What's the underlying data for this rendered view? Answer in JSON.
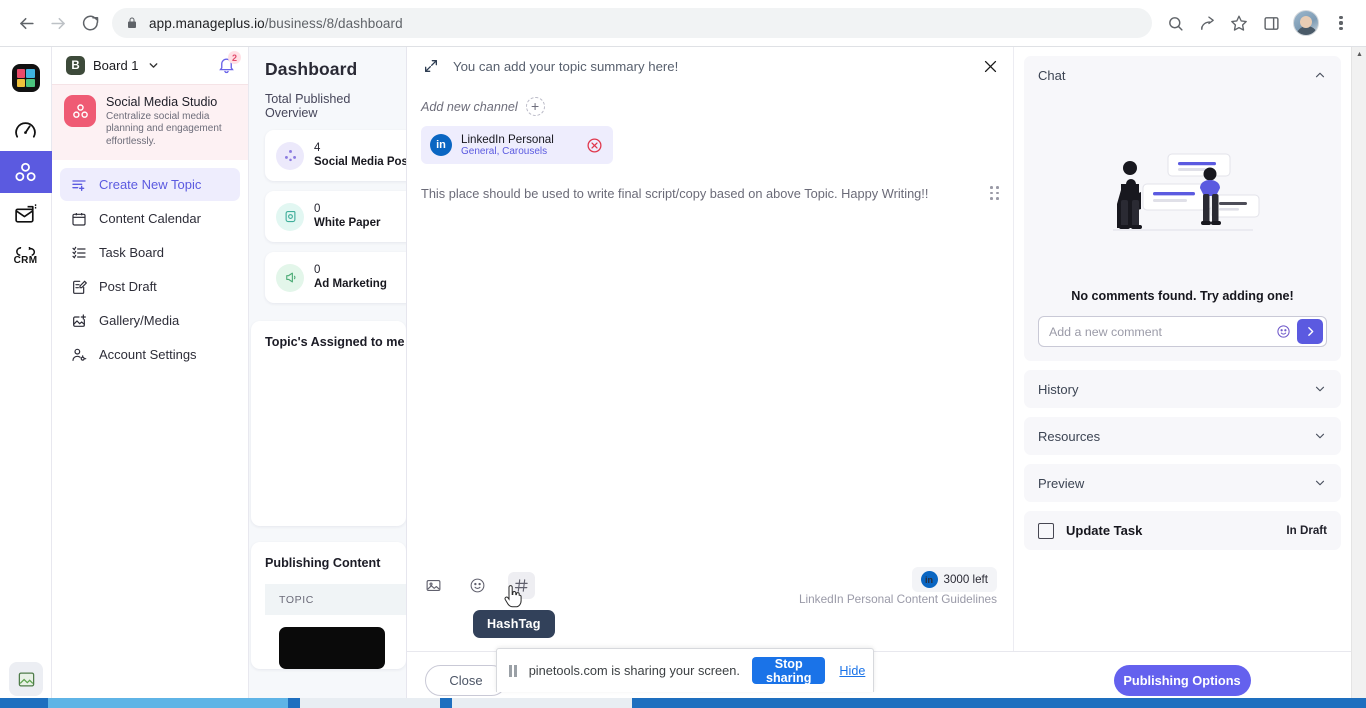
{
  "browser": {
    "url_host": "app.manageplus.io",
    "url_path": "/business/8/dashboard",
    "back_icon": "back-arrow-icon",
    "forward_icon": "forward-arrow-icon",
    "reload_icon": "reload-icon",
    "lock_icon": "lock-icon",
    "search_icon": "search-icon",
    "share_icon": "share-icon",
    "bookmark_icon": "star-icon",
    "sidepanel_icon": "side-panel-icon",
    "profile_icon": "profile-avatar",
    "menu_icon": "kebab-menu-icon"
  },
  "rail": {
    "items": [
      {
        "name": "app-logo",
        "label": ""
      },
      {
        "name": "dashboard-gauge",
        "label": ""
      },
      {
        "name": "social-media-studio",
        "label": ""
      },
      {
        "name": "email-campaign",
        "label": ""
      },
      {
        "name": "crm",
        "label": "CRM"
      }
    ],
    "active_index": 2
  },
  "sidebar": {
    "board": {
      "badge": "B",
      "name": "Board 1",
      "chevron": "chevron-down-icon"
    },
    "notification_count": "2",
    "studio": {
      "title": "Social Media Studio",
      "desc": "Centralize social media planning and engagement effortlessly."
    },
    "menu": [
      {
        "label": "Create New Topic",
        "icon": "create-topic-icon",
        "active": true
      },
      {
        "label": "Content Calendar",
        "icon": "calendar-icon",
        "active": false
      },
      {
        "label": "Task Board",
        "icon": "task-list-icon",
        "active": false
      },
      {
        "label": "Post Draft",
        "icon": "draft-edit-icon",
        "active": false
      },
      {
        "label": "Gallery/Media",
        "icon": "gallery-add-icon",
        "active": false
      },
      {
        "label": "Account Settings",
        "icon": "account-settings-icon",
        "active": false
      }
    ]
  },
  "dashboard": {
    "title": "Dashboard",
    "subtitle": "Total Published Overview",
    "stats": [
      {
        "count": "4",
        "label": "Social Media Post",
        "icon": "social-post-icon",
        "bg": "#ece9fb",
        "fg": "#8a7ae0"
      },
      {
        "count": "0",
        "label": "White Paper",
        "icon": "white-paper-icon",
        "bg": "#e2f7f2",
        "fg": "#3fae9a"
      },
      {
        "count": "0",
        "label": "Ad Marketing",
        "icon": "ad-marketing-icon",
        "bg": "#e3f6ea",
        "fg": "#4cab76"
      }
    ],
    "assigned_title": "Topic's Assigned to me",
    "publishing_title": "Publishing Content",
    "publishing_col_header": "TOPIC"
  },
  "editor": {
    "expand_icon": "expand-arrows-icon",
    "topic_summary": "You can add your topic summary here!",
    "close_icon": "close-x-icon",
    "add_channel_label": "Add new channel",
    "add_channel_plus": "+",
    "channel": {
      "platform_icon": "linkedin-icon",
      "platform_short": "in",
      "name": "LinkedIn Personal",
      "sub": "General, Carousels",
      "remove_icon": "remove-circle-icon"
    },
    "placeholder": "This place should be used to write final script/copy based on above Topic. Happy Writing!!",
    "drag_handle": "drag-handle-icon",
    "tools": [
      {
        "name": "insert-image-icon",
        "label": "Image"
      },
      {
        "name": "emoji-icon",
        "label": "Emoji"
      },
      {
        "name": "hashtag-icon",
        "label": "HashTag"
      }
    ],
    "tooltip": "HashTag",
    "char_count": "3000 left",
    "guidelines": "LinkedIn Personal Content Guidelines",
    "close_button": "Close"
  },
  "right_panel": {
    "sections": [
      {
        "title": "Chat",
        "expanded": true,
        "chevron": "chevron-up-icon"
      },
      {
        "title": "History",
        "expanded": false,
        "chevron": "chevron-down-icon"
      },
      {
        "title": "Resources",
        "expanded": false,
        "chevron": "chevron-down-icon"
      },
      {
        "title": "Preview",
        "expanded": false,
        "chevron": "chevron-down-icon"
      }
    ],
    "chat": {
      "empty_text": "No comments found. Try adding one!",
      "input_placeholder": "Add a new comment",
      "input_value": "",
      "emoji_icon": "emoji-smiley-icon",
      "send_icon": "send-arrow-icon"
    },
    "task": {
      "label": "Update Task",
      "status": "In Draft",
      "checkbox": "checkbox-unchecked"
    },
    "publish_button": "Publishing Options"
  },
  "share_bar": {
    "pause_icon": "pause-icon",
    "message": "pinetools.com is sharing your screen.",
    "stop_label": "Stop sharing",
    "hide_label": "Hide"
  },
  "colors": {
    "accent": "#5b5ae0",
    "publish": "#6461ee",
    "linkedin": "#0a66c2",
    "danger": "#e0374c",
    "chrome_blue": "#1a73e8",
    "studio_pink": "#ef5b74"
  }
}
